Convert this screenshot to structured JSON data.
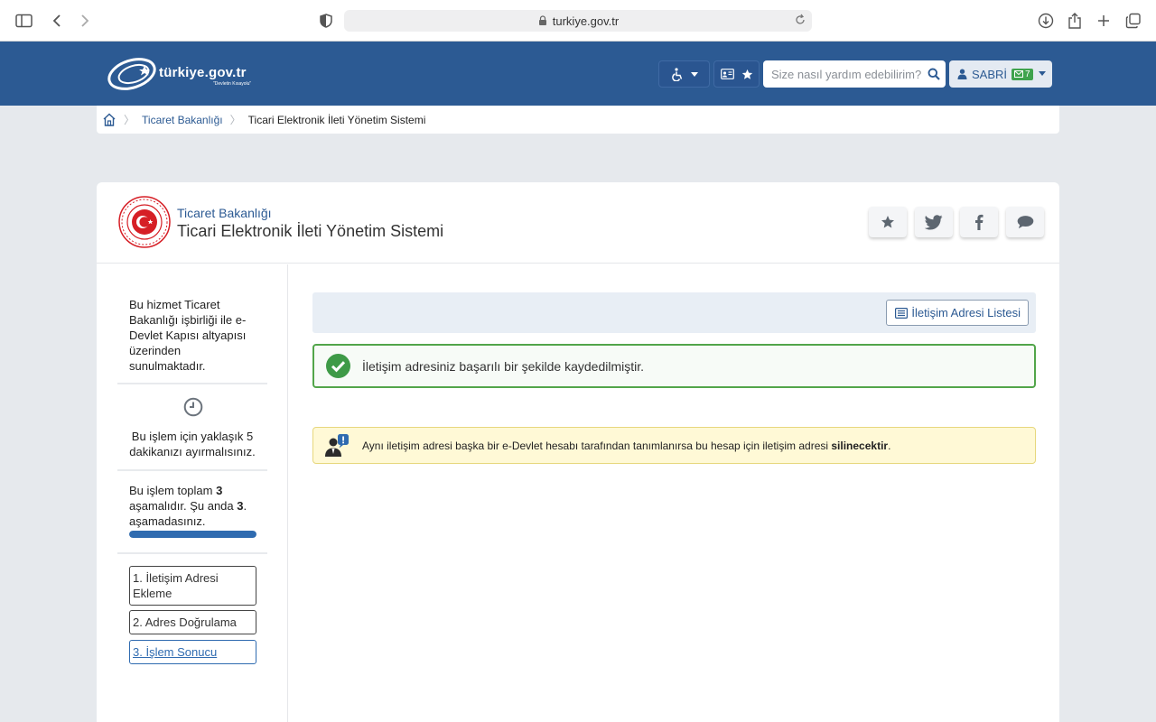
{
  "browser": {
    "url": "turkiye.gov.tr"
  },
  "header": {
    "logo_text": "türkiye.gov.tr",
    "logo_tagline": "\"Devletin Kısayolu\"",
    "search_placeholder": "Size nasıl yardım edebilirim?",
    "user_name": "SABRİ",
    "unread_messages": "7"
  },
  "breadcrumb": {
    "items": [
      "Ticaret Bakanlığı",
      "Ticari Elektronik İleti Yönetim Sistemi"
    ]
  },
  "service": {
    "institution": "Ticaret Bakanlığı",
    "title": "Ticari Elektronik İleti Yönetim Sistemi"
  },
  "sidebar": {
    "intro": "Bu hizmet Ticaret Bakanlığı işbirliği ile e-Devlet Kapısı altyapısı üzerinden sunulmaktadır.",
    "time_note": "Bu işlem için yaklaşık 5 dakikanızı ayırmalısınız.",
    "steps_prefix": "Bu işlem toplam ",
    "steps_total": "3",
    "steps_middle": " aşamalıdır. Şu anda ",
    "steps_current": "3",
    "steps_suffix": ". aşamadasınız.",
    "progress_fraction": 1.0,
    "steps": [
      "1. İletişim Adresi Ekleme",
      "2. Adres Doğrulama",
      "3. İşlem Sonucu"
    ]
  },
  "content": {
    "list_button": "İletişim Adresi Listesi",
    "success_message": "İletişim adresiniz başarılı bir şekilde kaydedilmiştir.",
    "warning_text": "Aynı iletişim adresi başka bir e-Devlet hesabı tarafından tanımlanırsa bu hesap için iletişim adresi ",
    "warning_bold": "silinecektir",
    "warning_end": "."
  },
  "colors": {
    "brand_blue": "#2c5a93",
    "success_green": "#52a54a",
    "warning_bg": "#fff9d6"
  }
}
